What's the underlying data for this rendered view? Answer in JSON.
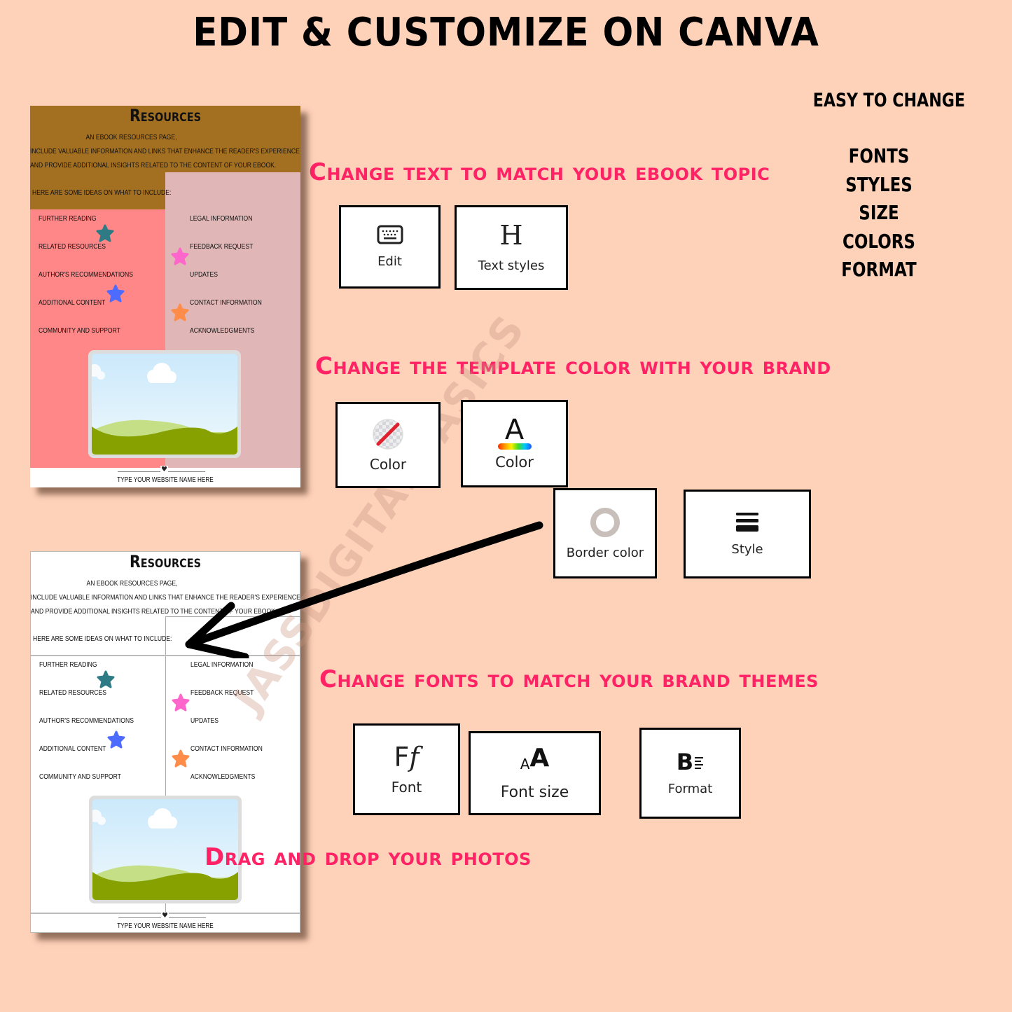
{
  "header": {
    "title": "EDIT & CUSTOMIZE ON CANVA"
  },
  "side_panel": {
    "heading": "EASY TO CHANGE",
    "items": [
      "FONTS",
      "STYLES",
      "SIZE",
      "COLORS",
      "FORMAT"
    ]
  },
  "sections": {
    "text": {
      "heading": "Change text to match your ebook topic"
    },
    "color": {
      "heading": "Change the template color with your brand"
    },
    "fonts": {
      "heading": "Change fonts to match your brand themes"
    },
    "photos": {
      "heading": "Drag and drop your photos"
    }
  },
  "tools": {
    "edit": {
      "label": "Edit",
      "icon": "keyboard-icon"
    },
    "text_styles": {
      "label": "Text styles",
      "icon": "heading-h-icon"
    },
    "color_fill": {
      "label": "Color",
      "icon": "no-fill-color-icon"
    },
    "text_color": {
      "label": "Color",
      "icon": "text-color-a-icon"
    },
    "border_color": {
      "label": "Border color",
      "icon": "border-ring-icon"
    },
    "style": {
      "label": "Style",
      "icon": "border-style-lines-icon"
    },
    "font": {
      "label": "Font",
      "icon": "font-ff-icon"
    },
    "font_size": {
      "label": "Font size",
      "icon": "font-size-aa-icon"
    },
    "format": {
      "label": "Format",
      "icon": "format-bold-list-icon"
    }
  },
  "template": {
    "title": "Resources",
    "intro_lines": [
      "An ebook resources page,",
      "include valuable information and links that enhance the reader's experience",
      "and provide additional insights related to the content of your ebook."
    ],
    "ideas_label": "Here are some ideas on what to include:",
    "left_items": [
      "Further reading",
      "Related resources",
      "Author's recommendations",
      "Additional content",
      "Community and support"
    ],
    "right_items": [
      "Legal information",
      "Feedback request",
      "Updates",
      "Contact information",
      "Acknowledgments"
    ],
    "footer_text": "Type your website name here"
  },
  "colors": {
    "background": "#FED1B9",
    "accent_heading": "#FF2366",
    "colored_header": "#A37022",
    "colored_left": "#FF8787",
    "colored_right": "#E0B6B6",
    "star_teal": "#2E7B86",
    "star_pink": "#FF66CC",
    "star_blue": "#4D6BFF",
    "star_orange": "#FF8C48"
  },
  "watermark": "JASSDIGITALBASICS"
}
